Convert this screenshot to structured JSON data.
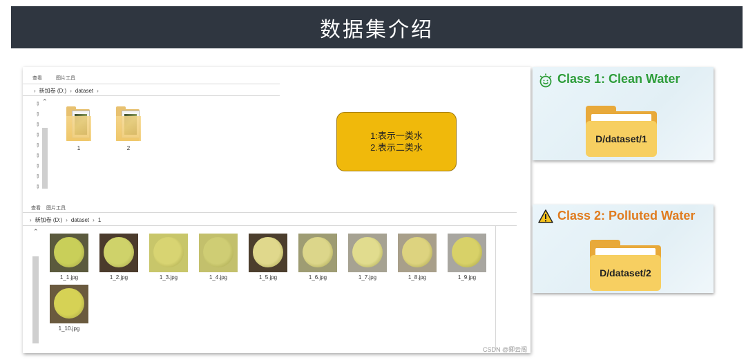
{
  "slide": {
    "title": "数据集介绍"
  },
  "explorer_top": {
    "tabs": [
      "查看",
      "图片工具"
    ],
    "path": [
      "新加卷 (D:)",
      "dataset"
    ],
    "folders": [
      {
        "name": "1"
      },
      {
        "name": "2"
      }
    ]
  },
  "explorer_bottom": {
    "tabs": [
      "查看",
      "图片工具"
    ],
    "path": [
      "新加卷 (D:)",
      "dataset",
      "1"
    ],
    "files": [
      {
        "name": "1_1.jpg",
        "bg": "#5b5a3d",
        "disc": "#c9cf59"
      },
      {
        "name": "1_2.jpg",
        "bg": "#4b3b2c",
        "disc": "#cfd26a"
      },
      {
        "name": "1_3.jpg",
        "bg": "#c8c66a",
        "disc": "#d8d472"
      },
      {
        "name": "1_4.jpg",
        "bg": "#c3c06c",
        "disc": "#cfcd74"
      },
      {
        "name": "1_5.jpg",
        "bg": "#4c3e2d",
        "disc": "#e0d88c"
      },
      {
        "name": "1_6.jpg",
        "bg": "#9e9c73",
        "disc": "#dcd68a"
      },
      {
        "name": "1_7.jpg",
        "bg": "#a6a292",
        "disc": "#e1dc8e"
      },
      {
        "name": "1_8.jpg",
        "bg": "#a89f8a",
        "disc": "#ddd37f"
      },
      {
        "name": "1_9.jpg",
        "bg": "#a8a6a0",
        "disc": "#d8d168"
      },
      {
        "name": "1_10.jpg",
        "bg": "#6a5a3e",
        "disc": "#d6d255"
      }
    ]
  },
  "note": {
    "line1": "1:表示一类水",
    "line2": "2.表示二类水"
  },
  "cards": [
    {
      "title": "Class 1: Clean Water",
      "folder_label": "D/dataset/1",
      "title_color": "#2e9d3a",
      "icon": "smile-water-icon"
    },
    {
      "title": "Class 2: Polluted Water",
      "folder_label": "D/dataset/2",
      "title_color": "#e07c1f",
      "icon": "warning-icon"
    }
  ],
  "watermark": "CSDN @卿云阁"
}
